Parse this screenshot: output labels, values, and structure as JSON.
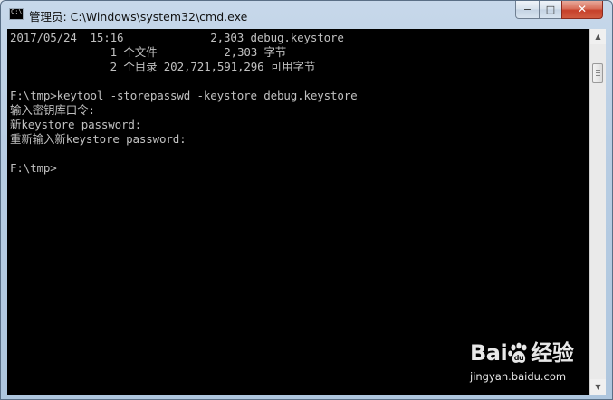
{
  "window": {
    "title": "管理员: C:\\Windows\\system32\\cmd.exe",
    "icon": "cmd-icon",
    "controls": {
      "minimize": "−",
      "maximize": "□",
      "close": "✕"
    }
  },
  "console": {
    "lines": [
      "2017/05/24  15:16             2,303 debug.keystore",
      "               1 个文件          2,303 字节",
      "               2 个目录 202,721,591,296 可用字节",
      "",
      "F:\\tmp>keytool -storepasswd -keystore debug.keystore",
      "输入密钥库口令:",
      "新keystore password:",
      "重新输入新keystore password:",
      "",
      "F:\\tmp>"
    ],
    "text_color": "#c0c0c0",
    "background": "#000000"
  },
  "scrollbar": {
    "up_icon": "▲",
    "down_icon": "▼"
  },
  "watermark": {
    "logo_left": "Bai",
    "logo_right": "经验",
    "url": "jingyan.baidu.com"
  }
}
